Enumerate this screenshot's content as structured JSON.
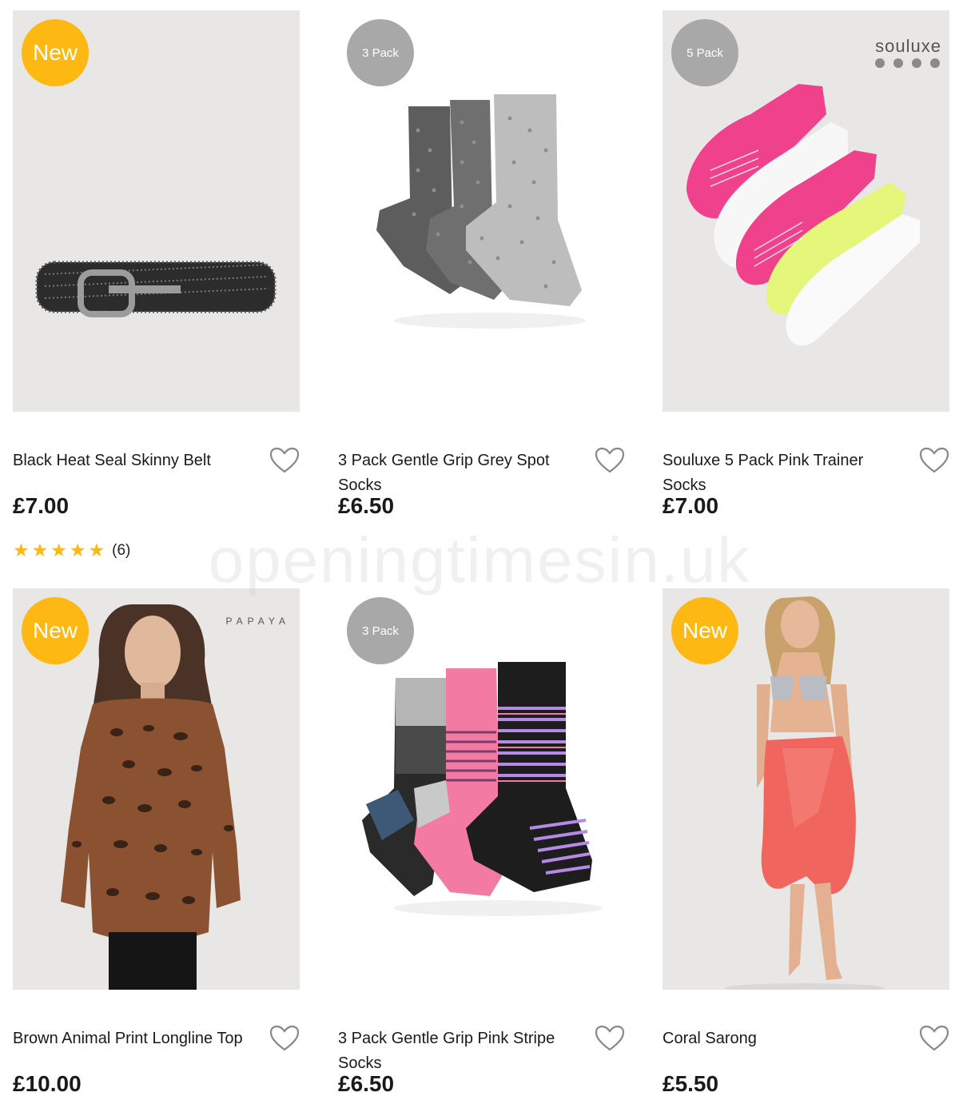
{
  "products": [
    {
      "title": "Black Heat Seal Skinny Belt",
      "price": "£7.00",
      "badge": "New",
      "rating_stars": 5,
      "rating_count": "(6)",
      "image": "studded-belt",
      "wishlist_icon": "heart-outline-icon"
    },
    {
      "title": "3 Pack Gentle Grip Grey Spot Socks",
      "price": "£6.50",
      "badge": "3 Pack",
      "image": "grey-spot-socks",
      "wishlist_icon": "heart-outline-icon"
    },
    {
      "title": "Souluxe 5 Pack Pink Trainer Socks",
      "price": "£7.00",
      "badge": "5 Pack",
      "brand": "souluxe",
      "image": "pink-trainer-socks",
      "wishlist_icon": "heart-outline-icon"
    },
    {
      "title": "Brown Animal Print Longline Top",
      "price": "£10.00",
      "badge": "New",
      "brand": "PAPAYA",
      "image": "model-animal-print-top",
      "wishlist_icon": "heart-outline-icon"
    },
    {
      "title": "3 Pack Gentle Grip Pink Stripe Socks",
      "price": "£6.50",
      "badge": "3 Pack",
      "image": "pink-stripe-socks",
      "wishlist_icon": "heart-outline-icon"
    },
    {
      "title": "Coral Sarong",
      "price": "£5.50",
      "badge": "New",
      "image": "model-coral-sarong",
      "wishlist_icon": "heart-outline-icon"
    }
  ],
  "watermark": "openingtimesin.uk",
  "colors": {
    "new_badge": "#fdb813",
    "pack_badge": "#a8a8a8",
    "star": "#fdb813",
    "image_bg": "#e8e7e5"
  }
}
